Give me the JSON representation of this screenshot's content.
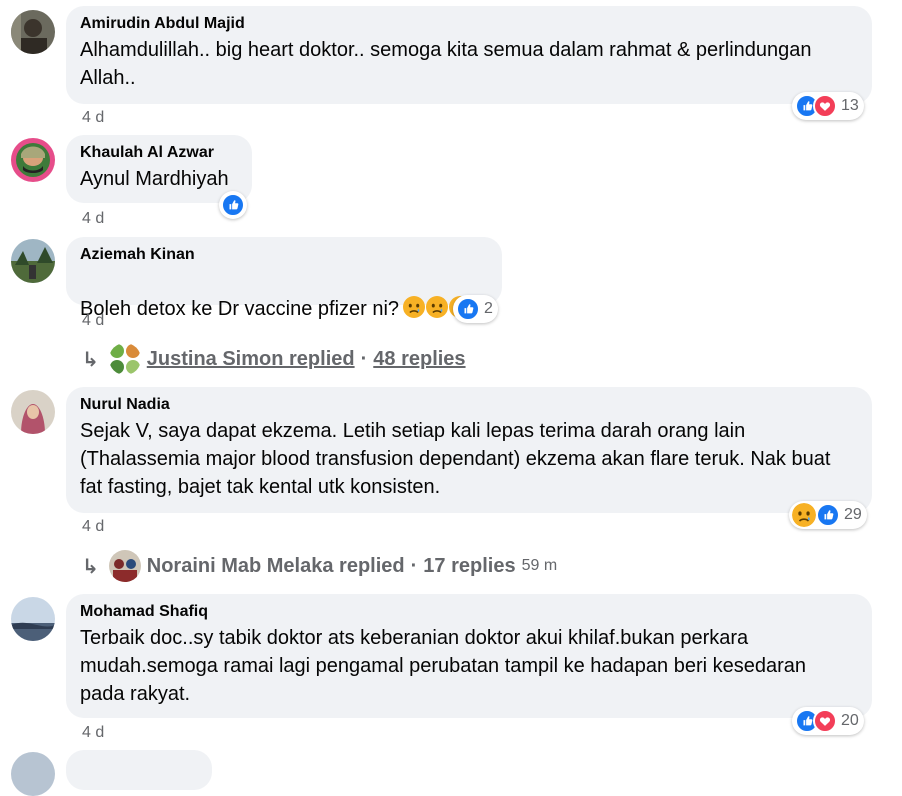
{
  "comments": [
    {
      "name": "Amirudin Abdul Majid",
      "text": "Alhamdulillah.. big heart doktor.. semoga kita semua dalam rahmat & perlindungan\nAllah..",
      "time": "4 d",
      "reaction_count": "13",
      "reactions": [
        "like-icon",
        "love-icon"
      ]
    },
    {
      "name": "Khaulah Al Azwar",
      "text": "Aynul Mardhiyah",
      "time": "4 d",
      "reactions": [
        "like-icon"
      ]
    },
    {
      "name": "Aziemah Kinan",
      "text": "Boleh detox ke Dr vaccine pfizer ni?",
      "time": "4 d",
      "reaction_count": "2",
      "reactions": [
        "like-icon"
      ],
      "emojis": [
        "sad-face-icon",
        "sad-face-icon",
        "sad-face-icon"
      ],
      "replies": {
        "replier": "Justina Simon replied",
        "separator": "·",
        "count": "48 replies"
      }
    },
    {
      "name": "Nurul Nadia",
      "text": "Sejak V, saya dapat ekzema. Letih setiap kali lepas terima darah orang lain\n(Thalassemia major blood transfusion dependant) ekzema akan flare teruk. Nak buat\nfat fasting, bajet tak kental utk konsisten.",
      "time": "4 d",
      "reaction_count": "29",
      "reactions": [
        "sad-icon",
        "like-icon"
      ],
      "replies": {
        "replier": "Noraini Mab Melaka replied",
        "separator": "·",
        "count": "17 replies",
        "ago": "59 m"
      }
    },
    {
      "name": "Mohamad Shafiq",
      "text": "Terbaik doc..sy tabik doktor ats keberanian doktor akui khilaf.bukan perkara\nmudah.semoga ramai lagi pengamal perubatan tampil ke hadapan beri kesedaran\npada rakyat.",
      "time": "4 d",
      "reaction_count": "20",
      "reactions": [
        "like-icon",
        "love-icon"
      ]
    }
  ],
  "icons": {
    "reply_arrow": "↳"
  },
  "colors": {
    "bubble": "#f0f2f5",
    "like": "#1877f2",
    "love": "#f33e58",
    "sad": "#f7b125",
    "meta": "#65676b"
  }
}
